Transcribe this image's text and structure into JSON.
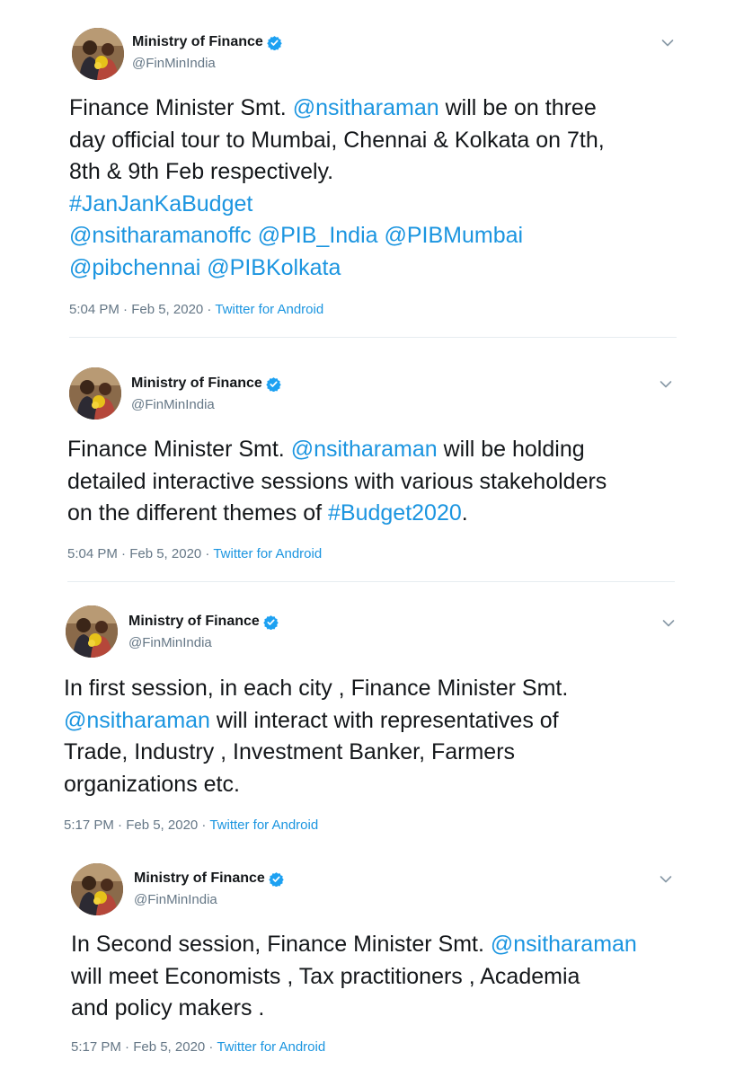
{
  "tweets": [
    {
      "author": "Ministry of Finance",
      "handle": "@FinMinIndia",
      "lines": [
        [
          {
            "t": "Finance Minister Smt. "
          },
          {
            "t": "@nsitharaman",
            "link": true
          },
          {
            "t": " will be on three"
          }
        ],
        [
          {
            "t": "day official tour to Mumbai, Chennai & Kolkata on 7th,"
          }
        ],
        [
          {
            "t": "8th & 9th Feb respectively."
          }
        ],
        [
          {
            "t": "#JanJanKaBudget",
            "link": true
          }
        ],
        [
          {
            "t": "@nsitharamanoffc",
            "link": true
          },
          {
            "t": " "
          },
          {
            "t": "@PIB_India",
            "link": true
          },
          {
            "t": " "
          },
          {
            "t": "@PIBMumbai",
            "link": true
          }
        ],
        [
          {
            "t": "@pibchennai",
            "link": true
          },
          {
            "t": " "
          },
          {
            "t": "@PIBKolkata",
            "link": true
          }
        ]
      ],
      "time": "5:04 PM · Feb 5, 2020 · ",
      "source": "Twitter for Android"
    },
    {
      "author": "Ministry of Finance",
      "handle": "@FinMinIndia",
      "lines": [
        [
          {
            "t": "Finance Minister Smt. "
          },
          {
            "t": "@nsitharaman",
            "link": true
          },
          {
            "t": " will be holding"
          }
        ],
        [
          {
            "t": "detailed interactive sessions with various stakeholders"
          }
        ],
        [
          {
            "t": "on the different themes of "
          },
          {
            "t": "#Budget2020",
            "link": true
          },
          {
            "t": "."
          }
        ]
      ],
      "time": "5:04 PM · Feb 5, 2020 · ",
      "source": "Twitter for Android"
    },
    {
      "author": "Ministry of Finance",
      "handle": "@FinMinIndia",
      "lines": [
        [
          {
            "t": "In first session, in each city , Finance Minister Smt."
          }
        ],
        [
          {
            "t": "@nsitharaman",
            "link": true
          },
          {
            "t": " will interact with representatives of"
          }
        ],
        [
          {
            "t": "Trade, Industry , Investment Banker, Farmers"
          }
        ],
        [
          {
            "t": "organizations etc."
          }
        ]
      ],
      "time": "5:17 PM · Feb 5, 2020 · ",
      "source": "Twitter for Android"
    },
    {
      "author": "Ministry of Finance",
      "handle": "@FinMinIndia",
      "lines": [
        [
          {
            "t": "In Second session, Finance Minister Smt. "
          },
          {
            "t": "@nsitharaman",
            "link": true
          }
        ],
        [
          {
            "t": " will meet Economists , Tax practitioners ,  Academia"
          }
        ],
        [
          {
            "t": "and policy makers ."
          }
        ]
      ],
      "time": "5:17 PM · Feb 5, 2020 · ",
      "source": "Twitter for Android"
    }
  ],
  "colors": {
    "link": "#1b95e0",
    "verified": "#1da1f2",
    "muted": "#657786"
  },
  "icons": {
    "verified": "verified-badge-icon",
    "menu": "chevron-down-icon"
  }
}
